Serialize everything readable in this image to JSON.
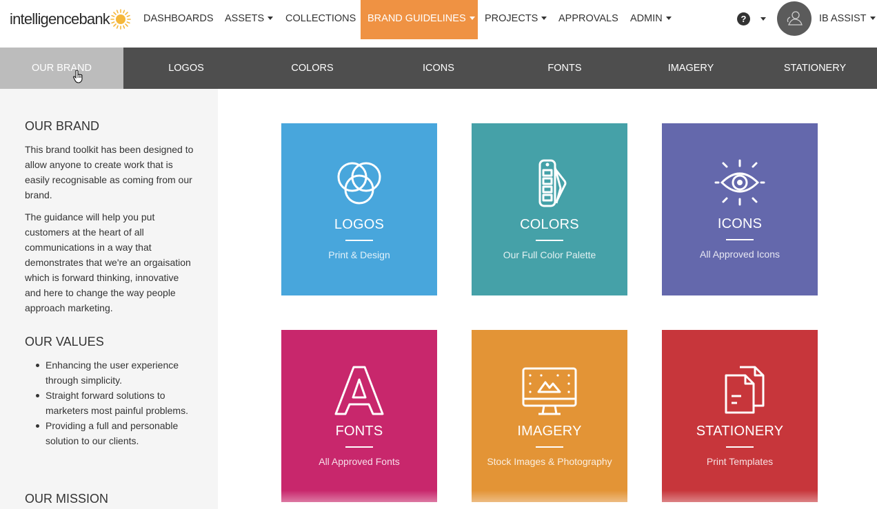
{
  "brand": {
    "logo_text": "intelligencebank",
    "sun_color": "#f5b73a"
  },
  "topnav": {
    "items": [
      {
        "label": "DASHBOARDS"
      },
      {
        "label": "ASSETS"
      },
      {
        "label": "COLLECTIONS"
      },
      {
        "label": "BRAND GUIDELINES"
      },
      {
        "label": "PROJECTS"
      },
      {
        "label": "APPROVALS"
      },
      {
        "label": "ADMIN"
      }
    ],
    "help_label": "?",
    "user_label": "IB ASSIST",
    "active_color": "#ef9243"
  },
  "subnav": {
    "items": [
      {
        "label": "OUR BRAND"
      },
      {
        "label": "LOGOS"
      },
      {
        "label": "COLORS"
      },
      {
        "label": "ICONS"
      },
      {
        "label": "FONTS"
      },
      {
        "label": "IMAGERY"
      },
      {
        "label": "STATIONERY"
      }
    ]
  },
  "sidebar": {
    "brand_heading": "OUR BRAND",
    "brand_p1": "This brand toolkit has been designed to allow anyone to create work that is easily recognisable as coming from our brand.",
    "brand_p2": "The guidance will help you put customers at the heart of all communications in a way that demonstrates that we're an orgaisation which is forward thinking, innovative and here to change the way people approach marketing.",
    "values_heading": "OUR VALUES",
    "values": [
      "Enhancing the user experience through simplicity.",
      "Straight forward solutions to marketers most painful problems.",
      "Providing a full and personable solution to our clients."
    ],
    "mission_heading": "OUR MISSION"
  },
  "tiles": [
    {
      "title": "LOGOS",
      "subtitle": "Print & Design",
      "color": "#48a6dc",
      "icon": "circles-icon"
    },
    {
      "title": "COLORS",
      "subtitle": "Our Full Color Palette",
      "color": "#45a1a8",
      "icon": "swatch-icon"
    },
    {
      "title": "ICONS",
      "subtitle": "All Approved Icons",
      "color": "#6468ac",
      "icon": "eye-icon"
    },
    {
      "title": "FONTS",
      "subtitle": "All Approved Fonts",
      "color": "#c8276c",
      "icon": "letter-a-icon"
    },
    {
      "title": "IMAGERY",
      "subtitle": "Stock Images & Photography",
      "color": "#e39436",
      "icon": "monitor-icon"
    },
    {
      "title": "STATIONERY",
      "subtitle": "Print Templates",
      "color": "#c7363b",
      "icon": "documents-icon"
    }
  ]
}
